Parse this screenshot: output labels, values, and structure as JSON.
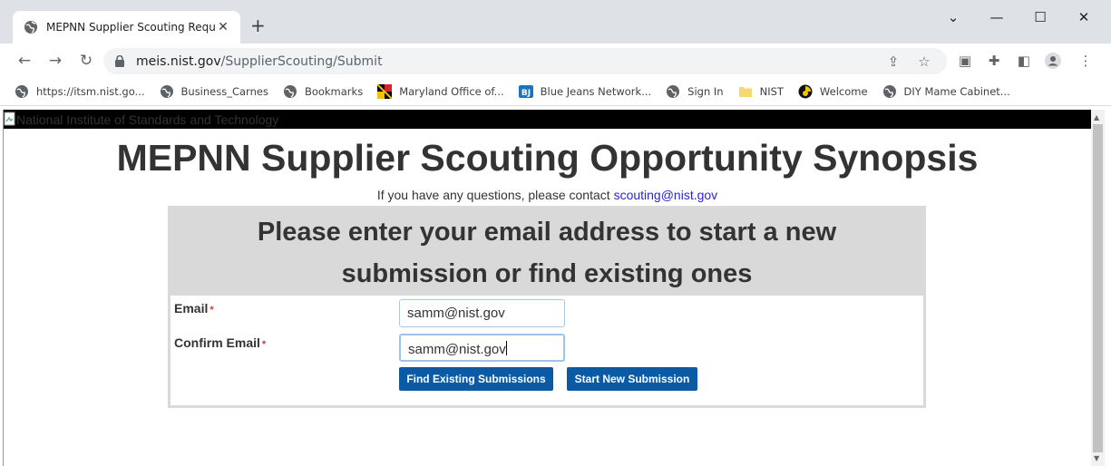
{
  "tab": {
    "title": "MEPNN Supplier Scouting Reque",
    "close": "✕"
  },
  "new_tab": "+",
  "window": {
    "dropdown": "⌄",
    "minimize": "—",
    "maximize": "☐",
    "close": "✕"
  },
  "toolbar": {
    "url_host": "meis.nist.gov",
    "url_path": "/SupplierScouting/Submit"
  },
  "bookmarks": [
    {
      "label": "https://itsm.nist.go...",
      "icon": "globe-icon"
    },
    {
      "label": "Business_Carnes",
      "icon": "globe-icon"
    },
    {
      "label": "Bookmarks",
      "icon": "globe-icon"
    },
    {
      "label": "Maryland Office of...",
      "icon": "maryland-flag-icon"
    },
    {
      "label": "Blue Jeans Network...",
      "icon": "bluejeans-icon"
    },
    {
      "label": "Sign In",
      "icon": "globe-icon"
    },
    {
      "label": "NIST",
      "icon": "folder-icon"
    },
    {
      "label": "Welcome",
      "icon": "welcome-icon"
    },
    {
      "label": "DIY Mame Cabinet...",
      "icon": "globe-icon"
    }
  ],
  "page": {
    "header_alt": "National Institute of Standards and Technology",
    "title": "MEPNN Supplier Scouting Opportunity Synopsis",
    "contact_text": "If you have any questions, please contact ",
    "contact_email": "scouting@nist.gov",
    "panel_heading_line1": "Please enter your email address to start a new",
    "panel_heading_line2": "submission or find existing ones",
    "form": {
      "email_label": "Email",
      "confirm_label": "Confirm Email",
      "required_mark": "*",
      "email_value": "samm@nist.gov",
      "confirm_value": "samm@nist.gov",
      "find_button": "Find Existing Submissions",
      "start_button": "Start New Submission"
    }
  },
  "colors": {
    "button": "#0a5aa6",
    "link": "#2b24d6",
    "panel_bg": "#d9d9d9",
    "header_bg": "#000000"
  }
}
